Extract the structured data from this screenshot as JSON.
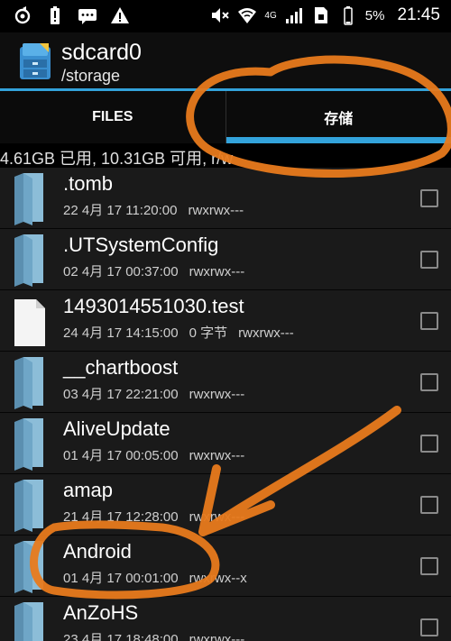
{
  "status_bar": {
    "network": "4G",
    "battery": "5%",
    "time": "21:45",
    "icons_left": [
      "sync-icon",
      "battery-alert-icon",
      "message-icon",
      "warning-icon"
    ],
    "icons_right": [
      "mute-icon",
      "wifi-icon",
      "signal-icon",
      "sim-icon",
      "battery-icon"
    ]
  },
  "app": {
    "title": "sdcard0",
    "path": "/storage",
    "accent_color": "#33a3db"
  },
  "tabs": [
    {
      "label": "FILES",
      "selected": false
    },
    {
      "label": "存储",
      "selected": true
    }
  ],
  "storage_info": "4.61GB 已用, 10.31GB 可用, r/w",
  "files": [
    {
      "name": ".tomb",
      "date": "22 4月 17 11:20:00",
      "size": "",
      "perms": "rwxrwx---",
      "type": "folder"
    },
    {
      "name": ".UTSystemConfig",
      "date": "02 4月 17 00:37:00",
      "size": "",
      "perms": "rwxrwx---",
      "type": "folder"
    },
    {
      "name": "1493014551030.test",
      "date": "24 4月 17 14:15:00",
      "size": "0 字节",
      "perms": "rwxrwx---",
      "type": "file"
    },
    {
      "name": "__chartboost",
      "date": "03 4月 17 22:21:00",
      "size": "",
      "perms": "rwxrwx---",
      "type": "folder"
    },
    {
      "name": "AliveUpdate",
      "date": "01 4月 17 00:05:00",
      "size": "",
      "perms": "rwxrwx---",
      "type": "folder"
    },
    {
      "name": "amap",
      "date": "21 4月 17 12:28:00",
      "size": "",
      "perms": "rwxrwx---",
      "type": "folder"
    },
    {
      "name": "Android",
      "date": "01 4月 17 00:01:00",
      "size": "",
      "perms": "rwxrwx--x",
      "type": "folder"
    },
    {
      "name": "AnZoHS",
      "date": "23 4月 17 18:48:00",
      "size": "",
      "perms": "rwxrwx---",
      "type": "folder"
    }
  ],
  "annotation_color": "#e87a1c"
}
